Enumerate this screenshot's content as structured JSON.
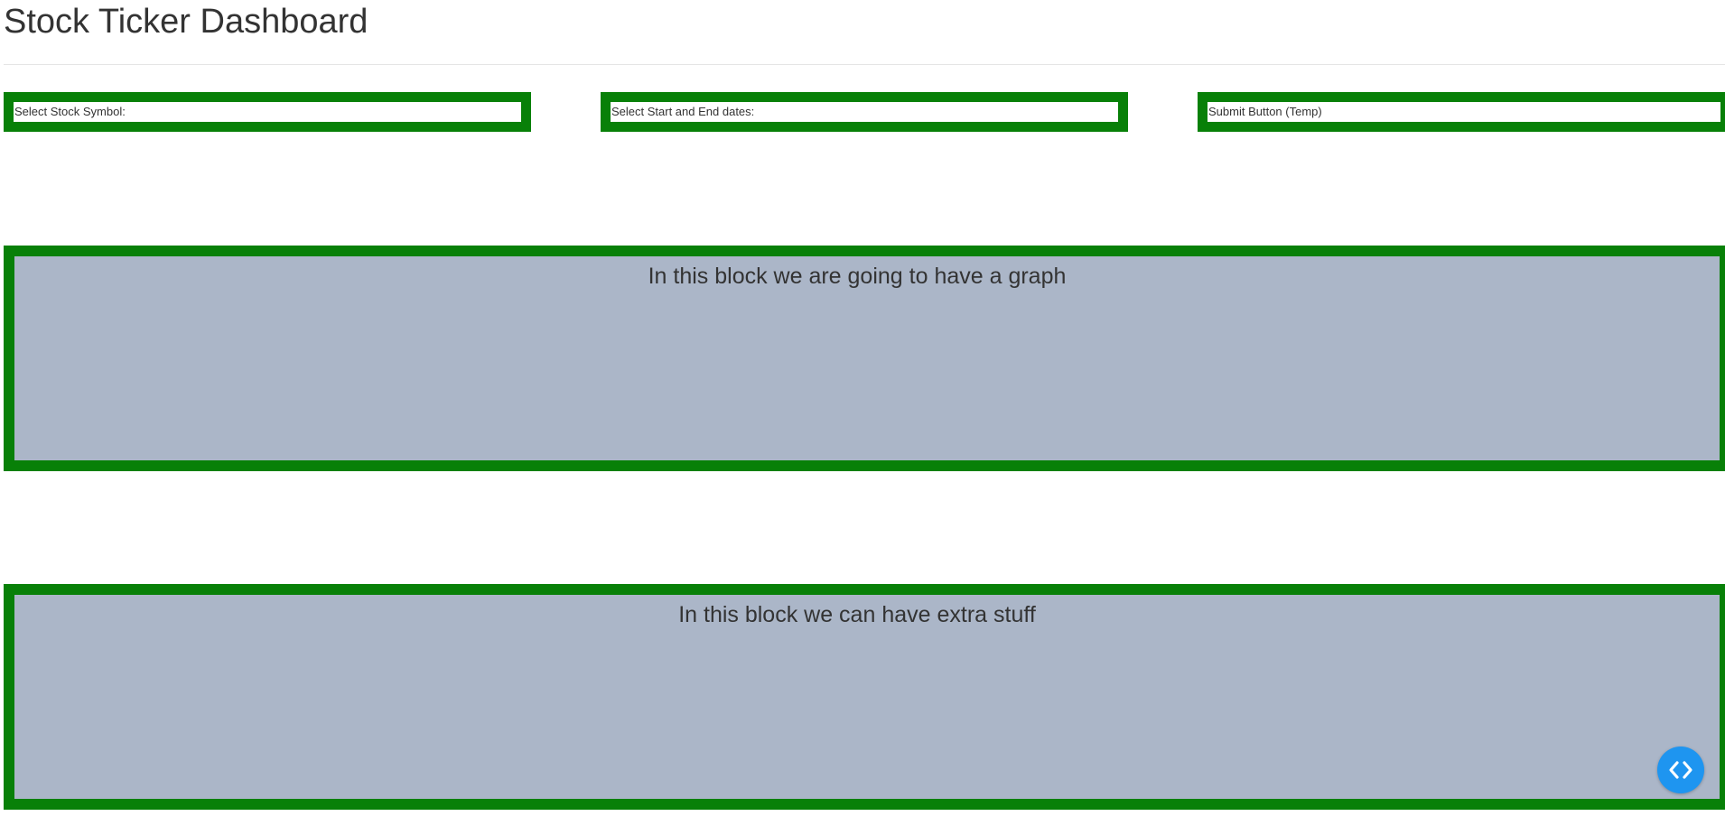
{
  "header": {
    "title": "Stock Ticker Dashboard"
  },
  "controls": {
    "symbol_label": "Select Stock Symbol:",
    "dates_label": "Select Start and End dates:",
    "submit_label": "Submit Button (Temp)"
  },
  "blocks": {
    "graph_text": "In this block we are going to have a graph",
    "extra_text": "In this block we can have extra stuff"
  },
  "colors": {
    "border": "#088008",
    "block_background": "#abb6c8",
    "dev_button": "#1e95f0",
    "text": "#333333"
  },
  "icons": {
    "dev_tools": "code-brackets-icon"
  }
}
